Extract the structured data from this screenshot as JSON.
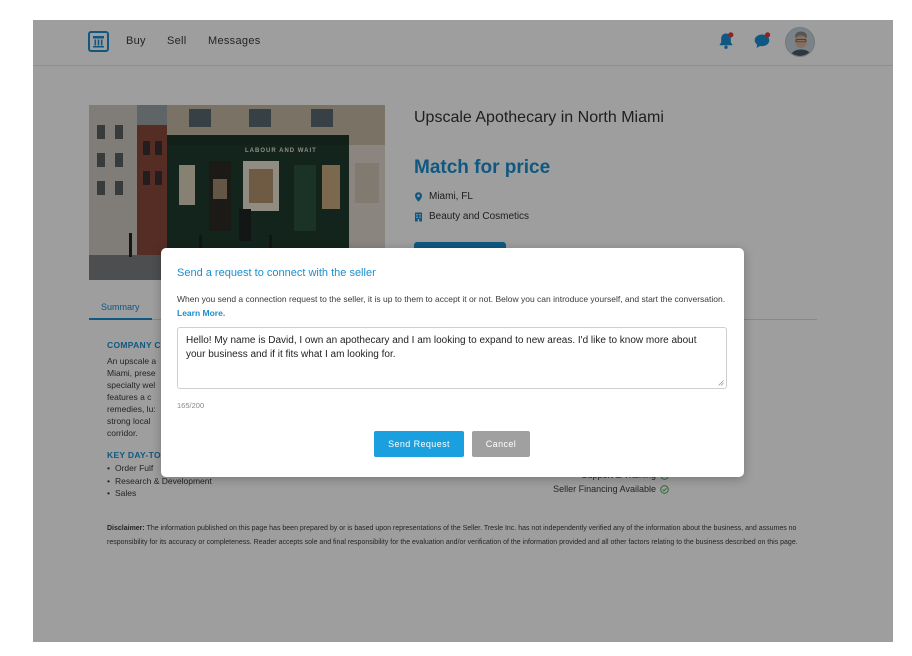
{
  "nav": {
    "logo_icon": "pillar-logo-icon",
    "items": [
      "Buy",
      "Sell",
      "Messages"
    ],
    "bell_icon": "bell-icon",
    "chat_icon": "chat-icon",
    "accent": "#1a8fd0",
    "notification_dot": "#e53935"
  },
  "listing": {
    "title": "Upscale Apothecary in North Miami",
    "price": "Match for price",
    "location": "Miami, FL",
    "category": "Beauty and Cosmetics",
    "storefront_sign": "LABOUR AND WAIT"
  },
  "tabs": {
    "summary": "Summary"
  },
  "sections": {
    "company_heading": "COMPANY C",
    "company_lines": [
      "An upscale a",
      "Miami, prese",
      "specialty wel",
      "features a c",
      "remedies, lu:",
      "strong local",
      "corridor."
    ],
    "key_heading": "KEY DAY-TO",
    "key_items": [
      "Order Fulf",
      "Research & Development",
      "Sales"
    ],
    "features": [
      "Support & Training",
      "Seller Financing Available"
    ]
  },
  "disclaimer": {
    "label": "Disclaimer:",
    "text": "The information published on this page has been prepared by or is based upon representations of the Seller. Tresle Inc. has not independently verified any of the information about the business, and assumes no responsibility for its accuracy or completeness. Reader accepts sole and final responsibility for the evaluation and/or verification of the information provided and all other factors relating to the business described on this page."
  },
  "modal": {
    "title": "Send a request to connect with the seller",
    "description": "When you send a connection request to the seller, it is up to them to accept it or not. Below you can introduce yourself, and start the conversation.",
    "learn_more": "Learn More.",
    "message": "Hello! My name is David, I own an apothecary and I am looking to expand to new areas. I'd like to know more about your business and if it fits what I am looking for.",
    "counter": "165/200",
    "send_label": "Send Request",
    "cancel_label": "Cancel"
  }
}
